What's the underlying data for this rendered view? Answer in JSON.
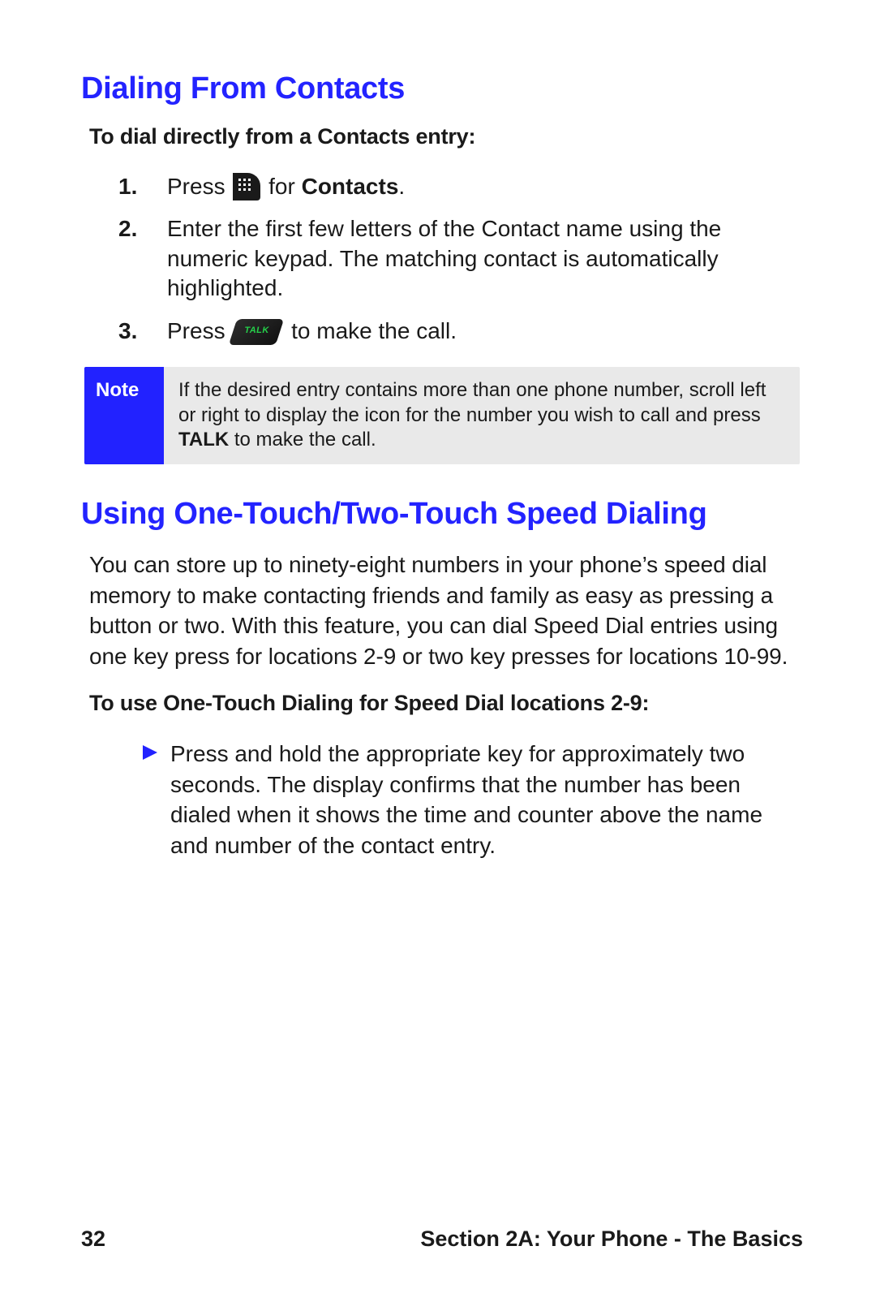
{
  "section1": {
    "title": "Dialing From Contacts",
    "subhead": "To dial directly from a Contacts entry:",
    "steps": {
      "s1": {
        "num": "1.",
        "a": "Press ",
        "b": " for ",
        "bold": "Contacts",
        "c": "."
      },
      "s2": {
        "num": "2.",
        "text": "Enter the first few letters of the Contact name using the numeric keypad. The matching contact is automatically highlighted."
      },
      "s3": {
        "num": "3.",
        "a": "Press ",
        "b": " to make the call."
      }
    },
    "note": {
      "label": "Note",
      "a": "If the desired entry contains more than one phone number, scroll left or right to display the icon for the number you wish to call and press ",
      "bold": "TALK",
      "b": " to make the call."
    }
  },
  "section2": {
    "title": "Using One-Touch/Two-Touch Speed Dialing",
    "para": "You can store up to ninety-eight numbers in your phone’s speed dial memory to make contacting friends and family as easy as pressing a button or two. With this feature, you can dial Speed Dial entries using one key press for locations 2-9 or two key presses for locations 10-99.",
    "subhead": "To use One-Touch Dialing for Speed Dial locations 2-9:",
    "bullet": "Press and hold the appropriate key for approximately two seconds. The display confirms that the number has been dialed when it shows the time and counter above the name and number of the contact entry."
  },
  "footer": {
    "page": "32",
    "label": "Section 2A: Your Phone - The Basics"
  }
}
